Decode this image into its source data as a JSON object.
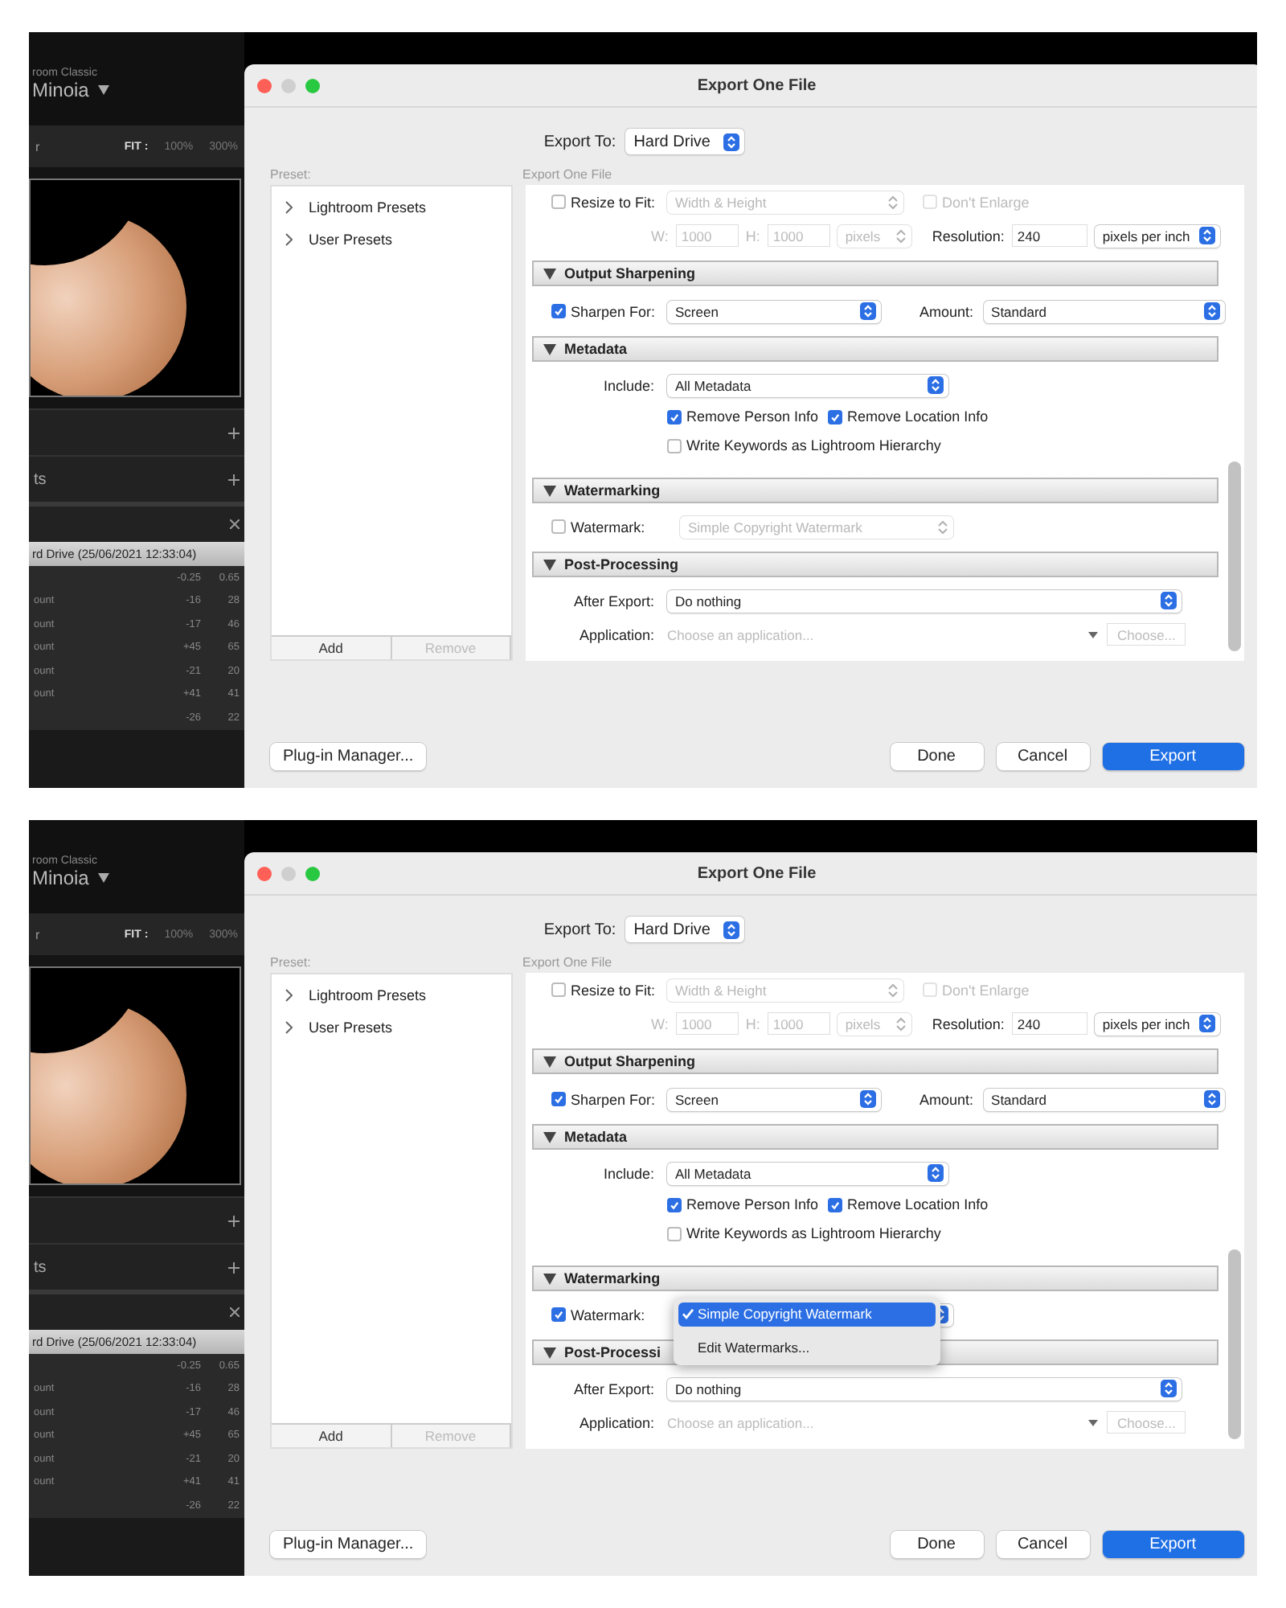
{
  "screenshots": [
    {
      "app": {
        "app_name": "room Classic",
        "catalog": "Minoia",
        "view_label": "r",
        "zoom": [
          {
            "label": "FIT :",
            "selected": true
          },
          {
            "label": "100%",
            "selected": false
          },
          {
            "label": "300%",
            "selected": false
          }
        ],
        "panel_title": "ts",
        "history": {
          "title": "rd Drive (25/06/2021 12:33:04)",
          "rows": [
            {
              "label": "",
              "values": [
                "-0.25",
                "0.65"
              ]
            },
            {
              "label": "ount",
              "values": [
                "-16",
                "28"
              ]
            },
            {
              "label": "ount",
              "values": [
                "-17",
                "46"
              ]
            },
            {
              "label": "ount",
              "values": [
                "+45",
                "65"
              ]
            },
            {
              "label": "ount",
              "values": [
                "-21",
                "20"
              ]
            },
            {
              "label": "ount",
              "values": [
                "+41",
                "41"
              ]
            },
            {
              "label": "",
              "values": [
                "-26",
                "22"
              ]
            }
          ]
        }
      },
      "dialog": {
        "title": "Export One File",
        "export_to": {
          "label": "Export To:",
          "value": "Hard Drive"
        },
        "preset": {
          "label": "Preset:",
          "items": [
            {
              "label": "Lightroom Presets",
              "expanded": false
            },
            {
              "label": "User Presets",
              "expanded": false
            }
          ],
          "buttons": [
            {
              "label": "Add",
              "disabled": false
            },
            {
              "label": "Remove",
              "disabled": true
            }
          ]
        },
        "settings": {
          "label": "Export One File",
          "resize": {
            "checkbox": {
              "label": "Resize to Fit:",
              "checked": false,
              "disabled": false
            },
            "mode": {
              "value": "Width & Height",
              "disabled": true
            },
            "dont_enlarge": {
              "label": "Don't Enlarge",
              "checked": false,
              "disabled": true
            },
            "w_label": "W:",
            "w": {
              "value": "1000",
              "disabled": true
            },
            "h_label": "H:",
            "h": {
              "value": "1000",
              "disabled": true
            },
            "units": {
              "value": "pixels",
              "disabled": true
            },
            "resolution_label": "Resolution:",
            "resolution": {
              "value": "240",
              "disabled": false
            },
            "resolution_units": {
              "value": "pixels per inch",
              "disabled": false
            }
          },
          "sections": [
            {
              "kind": "sharpening",
              "title": "Output Sharpening",
              "expanded": true,
              "sharpen": {
                "label": "Sharpen For:",
                "checked": true,
                "disabled": false
              },
              "sharpen_for": {
                "value": "Screen",
                "disabled": false
              },
              "amount_label": "Amount:",
              "amount": {
                "value": "Standard",
                "disabled": false
              }
            },
            {
              "kind": "metadata",
              "title": "Metadata",
              "expanded": true,
              "include_label": "Include:",
              "include": {
                "value": "All Metadata",
                "disabled": false
              },
              "options": [
                {
                  "label": "Remove Person Info",
                  "checked": true,
                  "disabled": false
                },
                {
                  "label": "Remove Location Info",
                  "checked": true,
                  "disabled": false
                },
                {
                  "label": "Write Keywords as Lightroom Hierarchy",
                  "checked": false,
                  "disabled": false
                }
              ]
            },
            {
              "kind": "watermarking",
              "title": "Watermarking",
              "expanded": true,
              "watermark": {
                "label": "Watermark:",
                "checked": false,
                "disabled": false
              },
              "style": {
                "value": "Simple Copyright Watermark",
                "disabled": true
              }
            },
            {
              "kind": "post",
              "title": "Post-Processing",
              "expanded": true,
              "after_label": "After Export:",
              "after": {
                "value": "Do nothing",
                "disabled": false
              },
              "application_label": "Application:",
              "application": {
                "placeholder": "Choose an application..."
              },
              "choose": {
                "label": "Choose...",
                "disabled": true
              }
            }
          ]
        },
        "plugin_button": "Plug-in Manager...",
        "buttons": [
          {
            "label": "Done",
            "kind": "normal"
          },
          {
            "label": "Cancel",
            "kind": "normal"
          },
          {
            "label": "Export",
            "kind": "default"
          }
        ]
      }
    },
    {
      "app": {
        "app_name": "room Classic",
        "catalog": "Minoia",
        "view_label": "r",
        "zoom": [
          {
            "label": "FIT :",
            "selected": true
          },
          {
            "label": "100%",
            "selected": false
          },
          {
            "label": "300%",
            "selected": false
          }
        ],
        "panel_title": "ts",
        "history": {
          "title": "rd Drive (25/06/2021 12:33:04)",
          "rows": [
            {
              "label": "",
              "values": [
                "-0.25",
                "0.65"
              ]
            },
            {
              "label": "ount",
              "values": [
                "-16",
                "28"
              ]
            },
            {
              "label": "ount",
              "values": [
                "-17",
                "46"
              ]
            },
            {
              "label": "ount",
              "values": [
                "+45",
                "65"
              ]
            },
            {
              "label": "ount",
              "values": [
                "-21",
                "20"
              ]
            },
            {
              "label": "ount",
              "values": [
                "+41",
                "41"
              ]
            },
            {
              "label": "",
              "values": [
                "-26",
                "22"
              ]
            }
          ]
        }
      },
      "dialog": {
        "title": "Export One File",
        "export_to": {
          "label": "Export To:",
          "value": "Hard Drive"
        },
        "preset": {
          "label": "Preset:",
          "items": [
            {
              "label": "Lightroom Presets",
              "expanded": false
            },
            {
              "label": "User Presets",
              "expanded": false
            }
          ],
          "buttons": [
            {
              "label": "Add",
              "disabled": false
            },
            {
              "label": "Remove",
              "disabled": true
            }
          ]
        },
        "settings": {
          "label": "Export One File",
          "resize": {
            "checkbox": {
              "label": "Resize to Fit:",
              "checked": false,
              "disabled": false
            },
            "mode": {
              "value": "Width & Height",
              "disabled": true
            },
            "dont_enlarge": {
              "label": "Don't Enlarge",
              "checked": false,
              "disabled": true
            },
            "w_label": "W:",
            "w": {
              "value": "1000",
              "disabled": true
            },
            "h_label": "H:",
            "h": {
              "value": "1000",
              "disabled": true
            },
            "units": {
              "value": "pixels",
              "disabled": true
            },
            "resolution_label": "Resolution:",
            "resolution": {
              "value": "240",
              "disabled": false
            },
            "resolution_units": {
              "value": "pixels per inch",
              "disabled": false
            }
          },
          "sections": [
            {
              "kind": "sharpening",
              "title": "Output Sharpening",
              "expanded": true,
              "sharpen": {
                "label": "Sharpen For:",
                "checked": true,
                "disabled": false
              },
              "sharpen_for": {
                "value": "Screen",
                "disabled": false
              },
              "amount_label": "Amount:",
              "amount": {
                "value": "Standard",
                "disabled": false
              }
            },
            {
              "kind": "metadata",
              "title": "Metadata",
              "expanded": true,
              "include_label": "Include:",
              "include": {
                "value": "All Metadata",
                "disabled": false
              },
              "options": [
                {
                  "label": "Remove Person Info",
                  "checked": true,
                  "disabled": false
                },
                {
                  "label": "Remove Location Info",
                  "checked": true,
                  "disabled": false
                },
                {
                  "label": "Write Keywords as Lightroom Hierarchy",
                  "checked": false,
                  "disabled": false
                }
              ]
            },
            {
              "kind": "watermarking",
              "title": "Watermarking",
              "expanded": true,
              "watermark": {
                "label": "Watermark:",
                "checked": true,
                "disabled": false
              },
              "style": {
                "disabled": false
              },
              "menu": {
                "items": [
                  {
                    "label": "Simple Copyright Watermark",
                    "selected": true
                  },
                  {
                    "label": "Edit Watermarks...",
                    "selected": false
                  }
                ]
              }
            },
            {
              "kind": "post",
              "title": "Post-Processi",
              "expanded": true,
              "after_label": "After Export:",
              "after": {
                "value": "Do nothing",
                "disabled": false
              },
              "application_label": "Application:",
              "application": {
                "placeholder": "Choose an application..."
              },
              "choose": {
                "label": "Choose...",
                "disabled": true
              }
            }
          ]
        },
        "plugin_button": "Plug-in Manager...",
        "buttons": [
          {
            "label": "Done",
            "kind": "normal"
          },
          {
            "label": "Cancel",
            "kind": "normal"
          },
          {
            "label": "Export",
            "kind": "default"
          }
        ]
      }
    }
  ]
}
